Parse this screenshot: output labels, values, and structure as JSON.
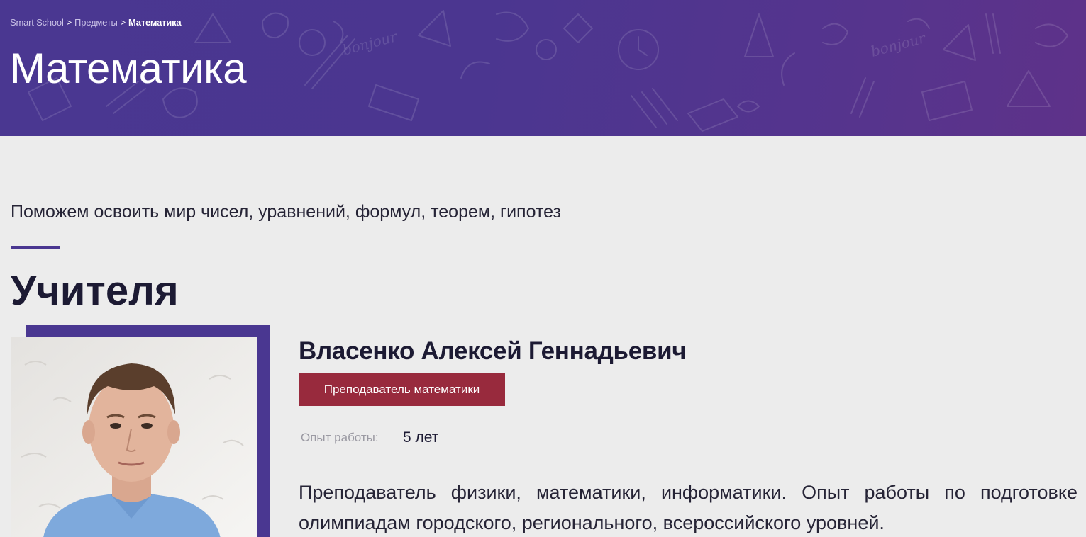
{
  "breadcrumb": {
    "items": [
      {
        "label": "Smart School",
        "current": false
      },
      {
        "label": "Предметы",
        "current": false
      },
      {
        "label": "Математика",
        "current": true
      }
    ],
    "separator": ">"
  },
  "hero": {
    "title": "Математика",
    "doodle_texts": [
      "bonjour",
      "bonjour"
    ]
  },
  "intro": {
    "subtitle": "Поможем освоить мир чисел, уравнений, формул, теорем, гипотез"
  },
  "teachers_section": {
    "title": "Учителя",
    "teachers": [
      {
        "name": "Власенко Алексей Геннадьевич",
        "role": "Преподаватель математики",
        "experience_label": "Опыт работы:",
        "experience_value": "5 лет",
        "bio": "Преподаватель физики, математики, информатики. Опыт работы по подготовке олимпиадам городского, регионального, всероссийского уровней."
      }
    ]
  },
  "colors": {
    "brand_purple": "#4a3791",
    "badge_red": "#982a3d",
    "background": "#ececec",
    "text_dark": "#1c1a33"
  }
}
